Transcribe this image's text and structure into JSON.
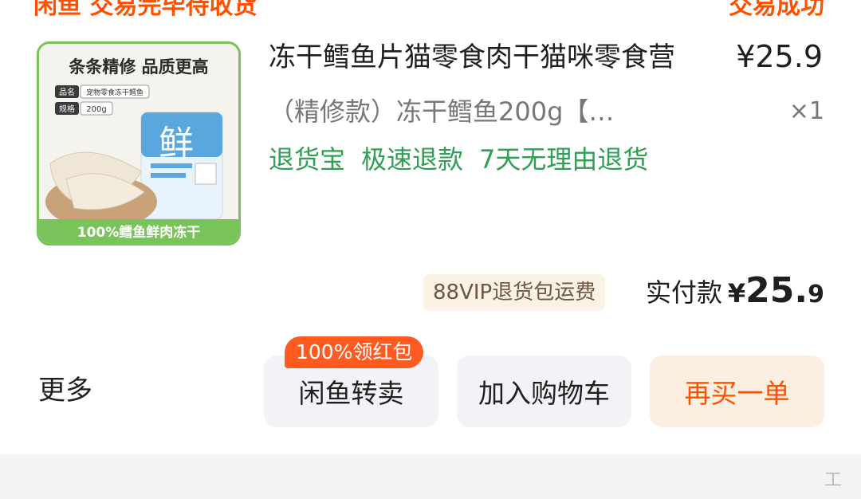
{
  "top_bar": {
    "left_text": "闲鱼 交易完毕待收货",
    "right_text": "交易成功"
  },
  "product": {
    "image": {
      "banner": "条条精修 品质更高",
      "name_label": "品名",
      "name_value": "宠物零食冻干鳕鱼",
      "spec_label": "规格",
      "spec_value": "200g",
      "bag_char": "鲜",
      "footer_text": "100%鳕鱼鲜肉冻干",
      "border_color": "#78c35a"
    },
    "title": "冻干鳕鱼片猫零食肉干猫咪零食营",
    "price": "¥25.9",
    "spec": "（精修款）冻干鳕鱼200g【…",
    "quantity": "×1",
    "service_tags": [
      "退货宝",
      "极速退款",
      "7天无理由退货"
    ],
    "tag_color": "#2e9f53"
  },
  "payment": {
    "vip_badge": "88VIP退货包运费",
    "paid_label": "实付款",
    "paid_symbol": "¥",
    "paid_integer": "25.",
    "paid_decimal": "9"
  },
  "actions": {
    "more": "更多",
    "promo_badge": "100%领红包",
    "xianyu_resell": "闲鱼转卖",
    "add_to_cart": "加入购物车",
    "buy_again": "再买一单",
    "accent_color": "#ff5000"
  },
  "footer": {
    "watermark": "工"
  }
}
